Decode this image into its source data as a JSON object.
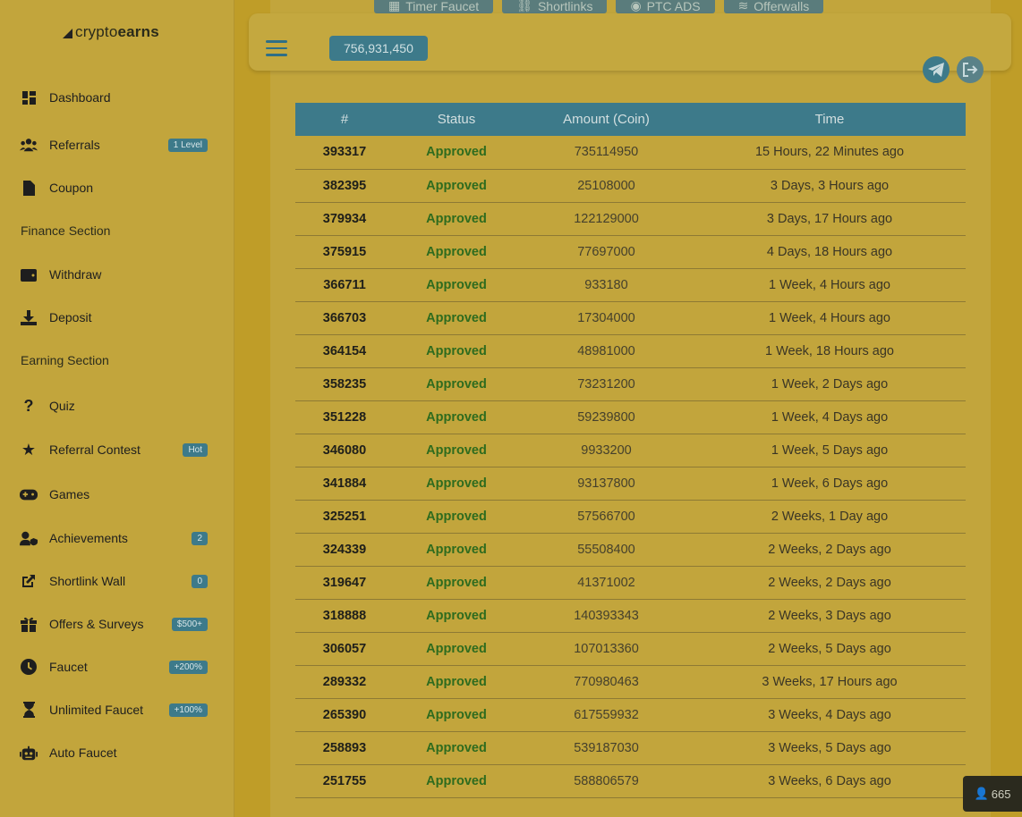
{
  "brand": {
    "prefix": "crypto",
    "suffix": "earns"
  },
  "top_tabs": [
    {
      "label": "Timer Faucet",
      "icon": "gift-icon"
    },
    {
      "label": "Shortlinks",
      "icon": "link-icon"
    },
    {
      "label": "PTC ADS",
      "icon": "eye-icon"
    },
    {
      "label": "Offerwalls",
      "icon": "layers-icon"
    }
  ],
  "header": {
    "balance": "756,931,450"
  },
  "sidebar": {
    "items": [
      {
        "label": "Dashboard",
        "badge": ""
      },
      {
        "label": "Referrals",
        "badge": "1 Level"
      },
      {
        "label": "Coupon",
        "badge": ""
      },
      {
        "section": "Finance Section"
      },
      {
        "label": "Withdraw",
        "badge": ""
      },
      {
        "label": "Deposit",
        "badge": ""
      },
      {
        "section": "Earning Section"
      },
      {
        "label": "Quiz",
        "badge": ""
      },
      {
        "label": "Referral Contest",
        "badge": "Hot"
      },
      {
        "label": "Games",
        "badge": ""
      },
      {
        "label": "Achievements",
        "badge": "2"
      },
      {
        "label": "Shortlink Wall",
        "badge": "0"
      },
      {
        "label": "Offers & Surveys",
        "badge": "$500+"
      },
      {
        "label": "Faucet",
        "badge": "+200%"
      },
      {
        "label": "Unlimited Faucet",
        "badge": "+100%"
      },
      {
        "label": "Auto Faucet",
        "badge": ""
      }
    ]
  },
  "table": {
    "headers": [
      "#",
      "Status",
      "Amount (Coin)",
      "Time"
    ],
    "rows": [
      [
        "393317",
        "Approved",
        "735114950",
        "15 Hours, 22 Minutes ago"
      ],
      [
        "382395",
        "Approved",
        "25108000",
        "3 Days, 3 Hours ago"
      ],
      [
        "379934",
        "Approved",
        "122129000",
        "3 Days, 17 Hours ago"
      ],
      [
        "375915",
        "Approved",
        "77697000",
        "4 Days, 18 Hours ago"
      ],
      [
        "366711",
        "Approved",
        "933180",
        "1 Week, 4 Hours ago"
      ],
      [
        "366703",
        "Approved",
        "17304000",
        "1 Week, 4 Hours ago"
      ],
      [
        "364154",
        "Approved",
        "48981000",
        "1 Week, 18 Hours ago"
      ],
      [
        "358235",
        "Approved",
        "73231200",
        "1 Week, 2 Days ago"
      ],
      [
        "351228",
        "Approved",
        "59239800",
        "1 Week, 4 Days ago"
      ],
      [
        "346080",
        "Approved",
        "9933200",
        "1 Week, 5 Days ago"
      ],
      [
        "341884",
        "Approved",
        "93137800",
        "1 Week, 6 Days ago"
      ],
      [
        "325251",
        "Approved",
        "57566700",
        "2 Weeks, 1 Day ago"
      ],
      [
        "324339",
        "Approved",
        "55508400",
        "2 Weeks, 2 Days ago"
      ],
      [
        "319647",
        "Approved",
        "41371002",
        "2 Weeks, 2 Days ago"
      ],
      [
        "318888",
        "Approved",
        "140393343",
        "2 Weeks, 3 Days ago"
      ],
      [
        "306057",
        "Approved",
        "107013360",
        "2 Weeks, 5 Days ago"
      ],
      [
        "289332",
        "Approved",
        "770980463",
        "3 Weeks, 17 Hours ago"
      ],
      [
        "265390",
        "Approved",
        "617559932",
        "3 Weeks, 4 Days ago"
      ],
      [
        "258893",
        "Approved",
        "539187030",
        "3 Weeks, 5 Days ago"
      ],
      [
        "251755",
        "Approved",
        "588806579",
        "3 Weeks, 6 Days ago"
      ]
    ]
  },
  "online_counter": "665",
  "colors": {
    "accent": "#3d7a8a",
    "approved": "#2e6b1e",
    "background": "#c2a53c"
  }
}
